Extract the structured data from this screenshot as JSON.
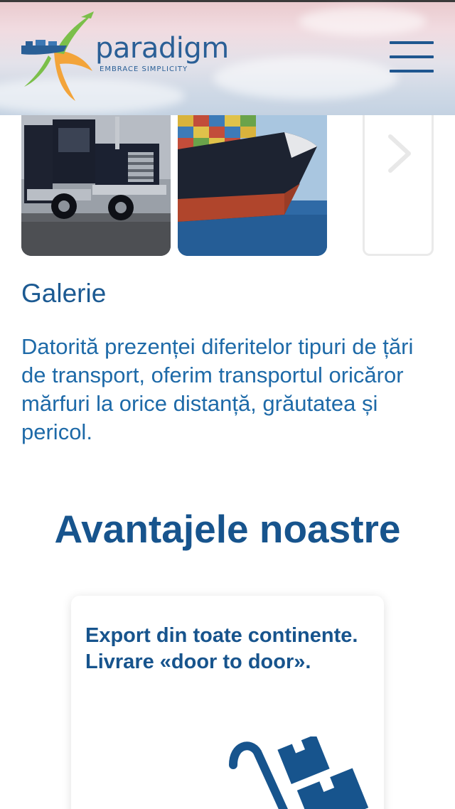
{
  "header": {
    "logo_text": "paradigm",
    "logo_tagline": "EMBRACE SIMPLICITY",
    "menu_icon": "hamburger-menu-icon"
  },
  "gallery": {
    "next_icon": "chevron-right-icon",
    "title": "Galerie",
    "description": "Datorită prezenței diferitelor tipuri de țări de transport, oferim transportul oricăror mărfuri la orice distanță, grăutatea și pericol."
  },
  "advantages": {
    "title": "Avantajele noastre",
    "cards": [
      {
        "title": "Export din toate continente. Livrare «door to door».",
        "icon": "hand-truck-boxes-icon"
      }
    ]
  },
  "colors": {
    "brand_blue": "#17548d",
    "text_blue": "#1e6aa8",
    "logo_orange": "#f3a43a",
    "logo_green": "#7bbf4a"
  }
}
